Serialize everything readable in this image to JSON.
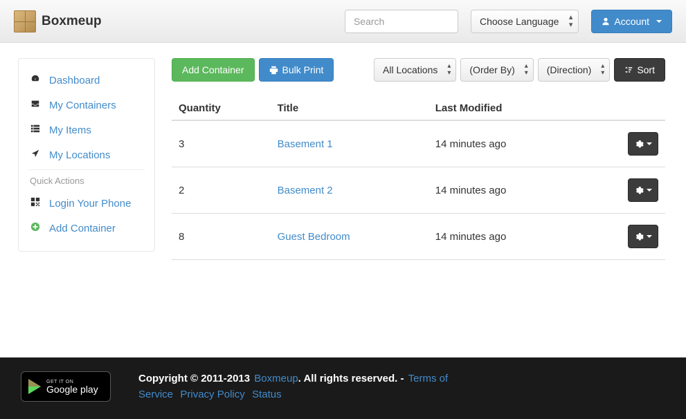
{
  "brand": {
    "name": "Boxmeup"
  },
  "search": {
    "placeholder": "Search"
  },
  "language_selector": {
    "label": "Choose Language"
  },
  "account_button": {
    "label": "Account"
  },
  "sidebar": {
    "items": [
      {
        "label": "Dashboard"
      },
      {
        "label": "My Containers"
      },
      {
        "label": "My Items"
      },
      {
        "label": "My Locations"
      }
    ],
    "quick_header": "Quick Actions",
    "quick": [
      {
        "label": "Login Your Phone"
      },
      {
        "label": "Add Container"
      }
    ]
  },
  "toolbar": {
    "add_container": "Add Container",
    "bulk_print": "Bulk Print",
    "filter_location": "All Locations",
    "filter_order": "(Order By)",
    "filter_direction": "(Direction)",
    "sort": "Sort"
  },
  "table": {
    "headers": {
      "qty": "Quantity",
      "title": "Title",
      "modified": "Last Modified"
    },
    "rows": [
      {
        "qty": "3",
        "title": "Basement 1",
        "modified": "14 minutes ago"
      },
      {
        "qty": "2",
        "title": "Basement 2",
        "modified": "14 minutes ago"
      },
      {
        "qty": "8",
        "title": "Guest Bedroom",
        "modified": "14 minutes ago"
      }
    ]
  },
  "footer": {
    "gplay_small": "GET IT ON",
    "gplay_main": "Google play",
    "copyright_prefix": "Copyright © 2011-2013 ",
    "brand_link": "Boxmeup",
    "copyright_suffix": ". All rights reserved. - ",
    "links": {
      "tos": "Terms of Service",
      "privacy": "Privacy Policy",
      "status": "Status"
    }
  }
}
